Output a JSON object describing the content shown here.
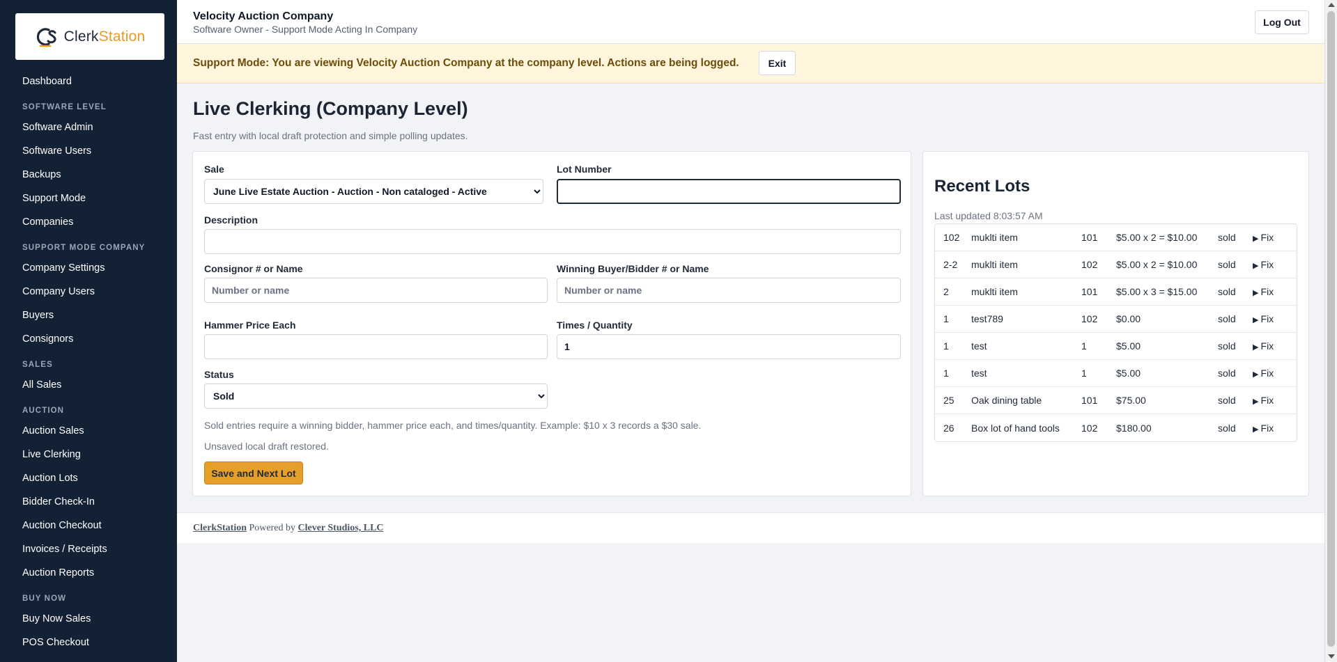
{
  "brand": {
    "logo_part1": "Clerk",
    "logo_part2": "Station"
  },
  "sidebar": {
    "items": [
      {
        "type": "link",
        "label": "Dashboard"
      },
      {
        "type": "section",
        "label": "SOFTWARE LEVEL"
      },
      {
        "type": "link",
        "label": "Software Admin"
      },
      {
        "type": "link",
        "label": "Software Users"
      },
      {
        "type": "link",
        "label": "Backups"
      },
      {
        "type": "link",
        "label": "Support Mode"
      },
      {
        "type": "link",
        "label": "Companies"
      },
      {
        "type": "section",
        "label": "SUPPORT MODE COMPANY"
      },
      {
        "type": "link",
        "label": "Company Settings"
      },
      {
        "type": "link",
        "label": "Company Users"
      },
      {
        "type": "link",
        "label": "Buyers"
      },
      {
        "type": "link",
        "label": "Consignors"
      },
      {
        "type": "section",
        "label": "SALES"
      },
      {
        "type": "link",
        "label": "All Sales"
      },
      {
        "type": "section",
        "label": "AUCTION"
      },
      {
        "type": "link",
        "label": "Auction Sales"
      },
      {
        "type": "link",
        "label": "Live Clerking"
      },
      {
        "type": "link",
        "label": "Auction Lots"
      },
      {
        "type": "link",
        "label": "Bidder Check-In"
      },
      {
        "type": "link",
        "label": "Auction Checkout"
      },
      {
        "type": "link",
        "label": "Invoices / Receipts"
      },
      {
        "type": "link",
        "label": "Auction Reports"
      },
      {
        "type": "section",
        "label": "BUY NOW"
      },
      {
        "type": "link",
        "label": "Buy Now Sales"
      },
      {
        "type": "link",
        "label": "POS Checkout"
      }
    ]
  },
  "header": {
    "company": "Velocity Auction Company",
    "subtitle": "Software Owner - Support Mode Acting In Company",
    "logout_label": "Log Out"
  },
  "banner": {
    "text": "Support Mode: You are viewing Velocity Auction Company at the company level. Actions are being logged.",
    "exit_label": "Exit"
  },
  "page": {
    "title": "Live Clerking (Company Level)",
    "subtitle": "Fast entry with local draft protection and simple polling updates."
  },
  "form": {
    "sale_label": "Sale",
    "sale_selected": "June Live Estate Auction - Auction - Non cataloged - Active",
    "lot_label": "Lot Number",
    "lot_value": "",
    "description_label": "Description",
    "description_value": "",
    "consignor_label": "Consignor # or Name",
    "consignor_placeholder": "Number or name",
    "buyer_label": "Winning Buyer/Bidder # or Name",
    "buyer_placeholder": "Number or name",
    "hammer_label": "Hammer Price Each",
    "hammer_value": "",
    "qty_label": "Times / Quantity",
    "qty_value": "1",
    "status_label": "Status",
    "status_selected": "Sold",
    "hint": "Sold entries require a winning bidder, hammer price each, and times/quantity. Example: $10 x 3 records a $30 sale.",
    "draft_note": "Unsaved local draft restored.",
    "save_label": "Save and Next Lot"
  },
  "recent": {
    "title": "Recent Lots",
    "updated": "Last updated 8:03:57 AM",
    "fix_label": "Fix",
    "rows": [
      {
        "lot": "102",
        "desc": "muklti item",
        "bidder": "101",
        "price": "$5.00 x 2 = $10.00",
        "status": "sold"
      },
      {
        "lot": "2-2",
        "desc": "muklti item",
        "bidder": "102",
        "price": "$5.00 x 2 = $10.00",
        "status": "sold"
      },
      {
        "lot": "2",
        "desc": "muklti item",
        "bidder": "101",
        "price": "$5.00 x 3 = $15.00",
        "status": "sold"
      },
      {
        "lot": "1",
        "desc": "test789",
        "bidder": "102",
        "price": "$0.00",
        "status": "sold"
      },
      {
        "lot": "1",
        "desc": "test",
        "bidder": "1",
        "price": "$5.00",
        "status": "sold"
      },
      {
        "lot": "1",
        "desc": "test",
        "bidder": "1",
        "price": "$5.00",
        "status": "sold"
      },
      {
        "lot": "25",
        "desc": "Oak dining table",
        "bidder": "101",
        "price": "$75.00",
        "status": "sold"
      },
      {
        "lot": "26",
        "desc": "Box lot of hand tools",
        "bidder": "102",
        "price": "$180.00",
        "status": "sold"
      }
    ]
  },
  "footer": {
    "app_link": "ClerkStation",
    "powered_by": "Powered by",
    "company_link": "Clever Studios, LLC"
  },
  "colors": {
    "sidebar_bg": "#132135",
    "accent": "#e6a02a",
    "banner_bg": "#fef5dc"
  }
}
